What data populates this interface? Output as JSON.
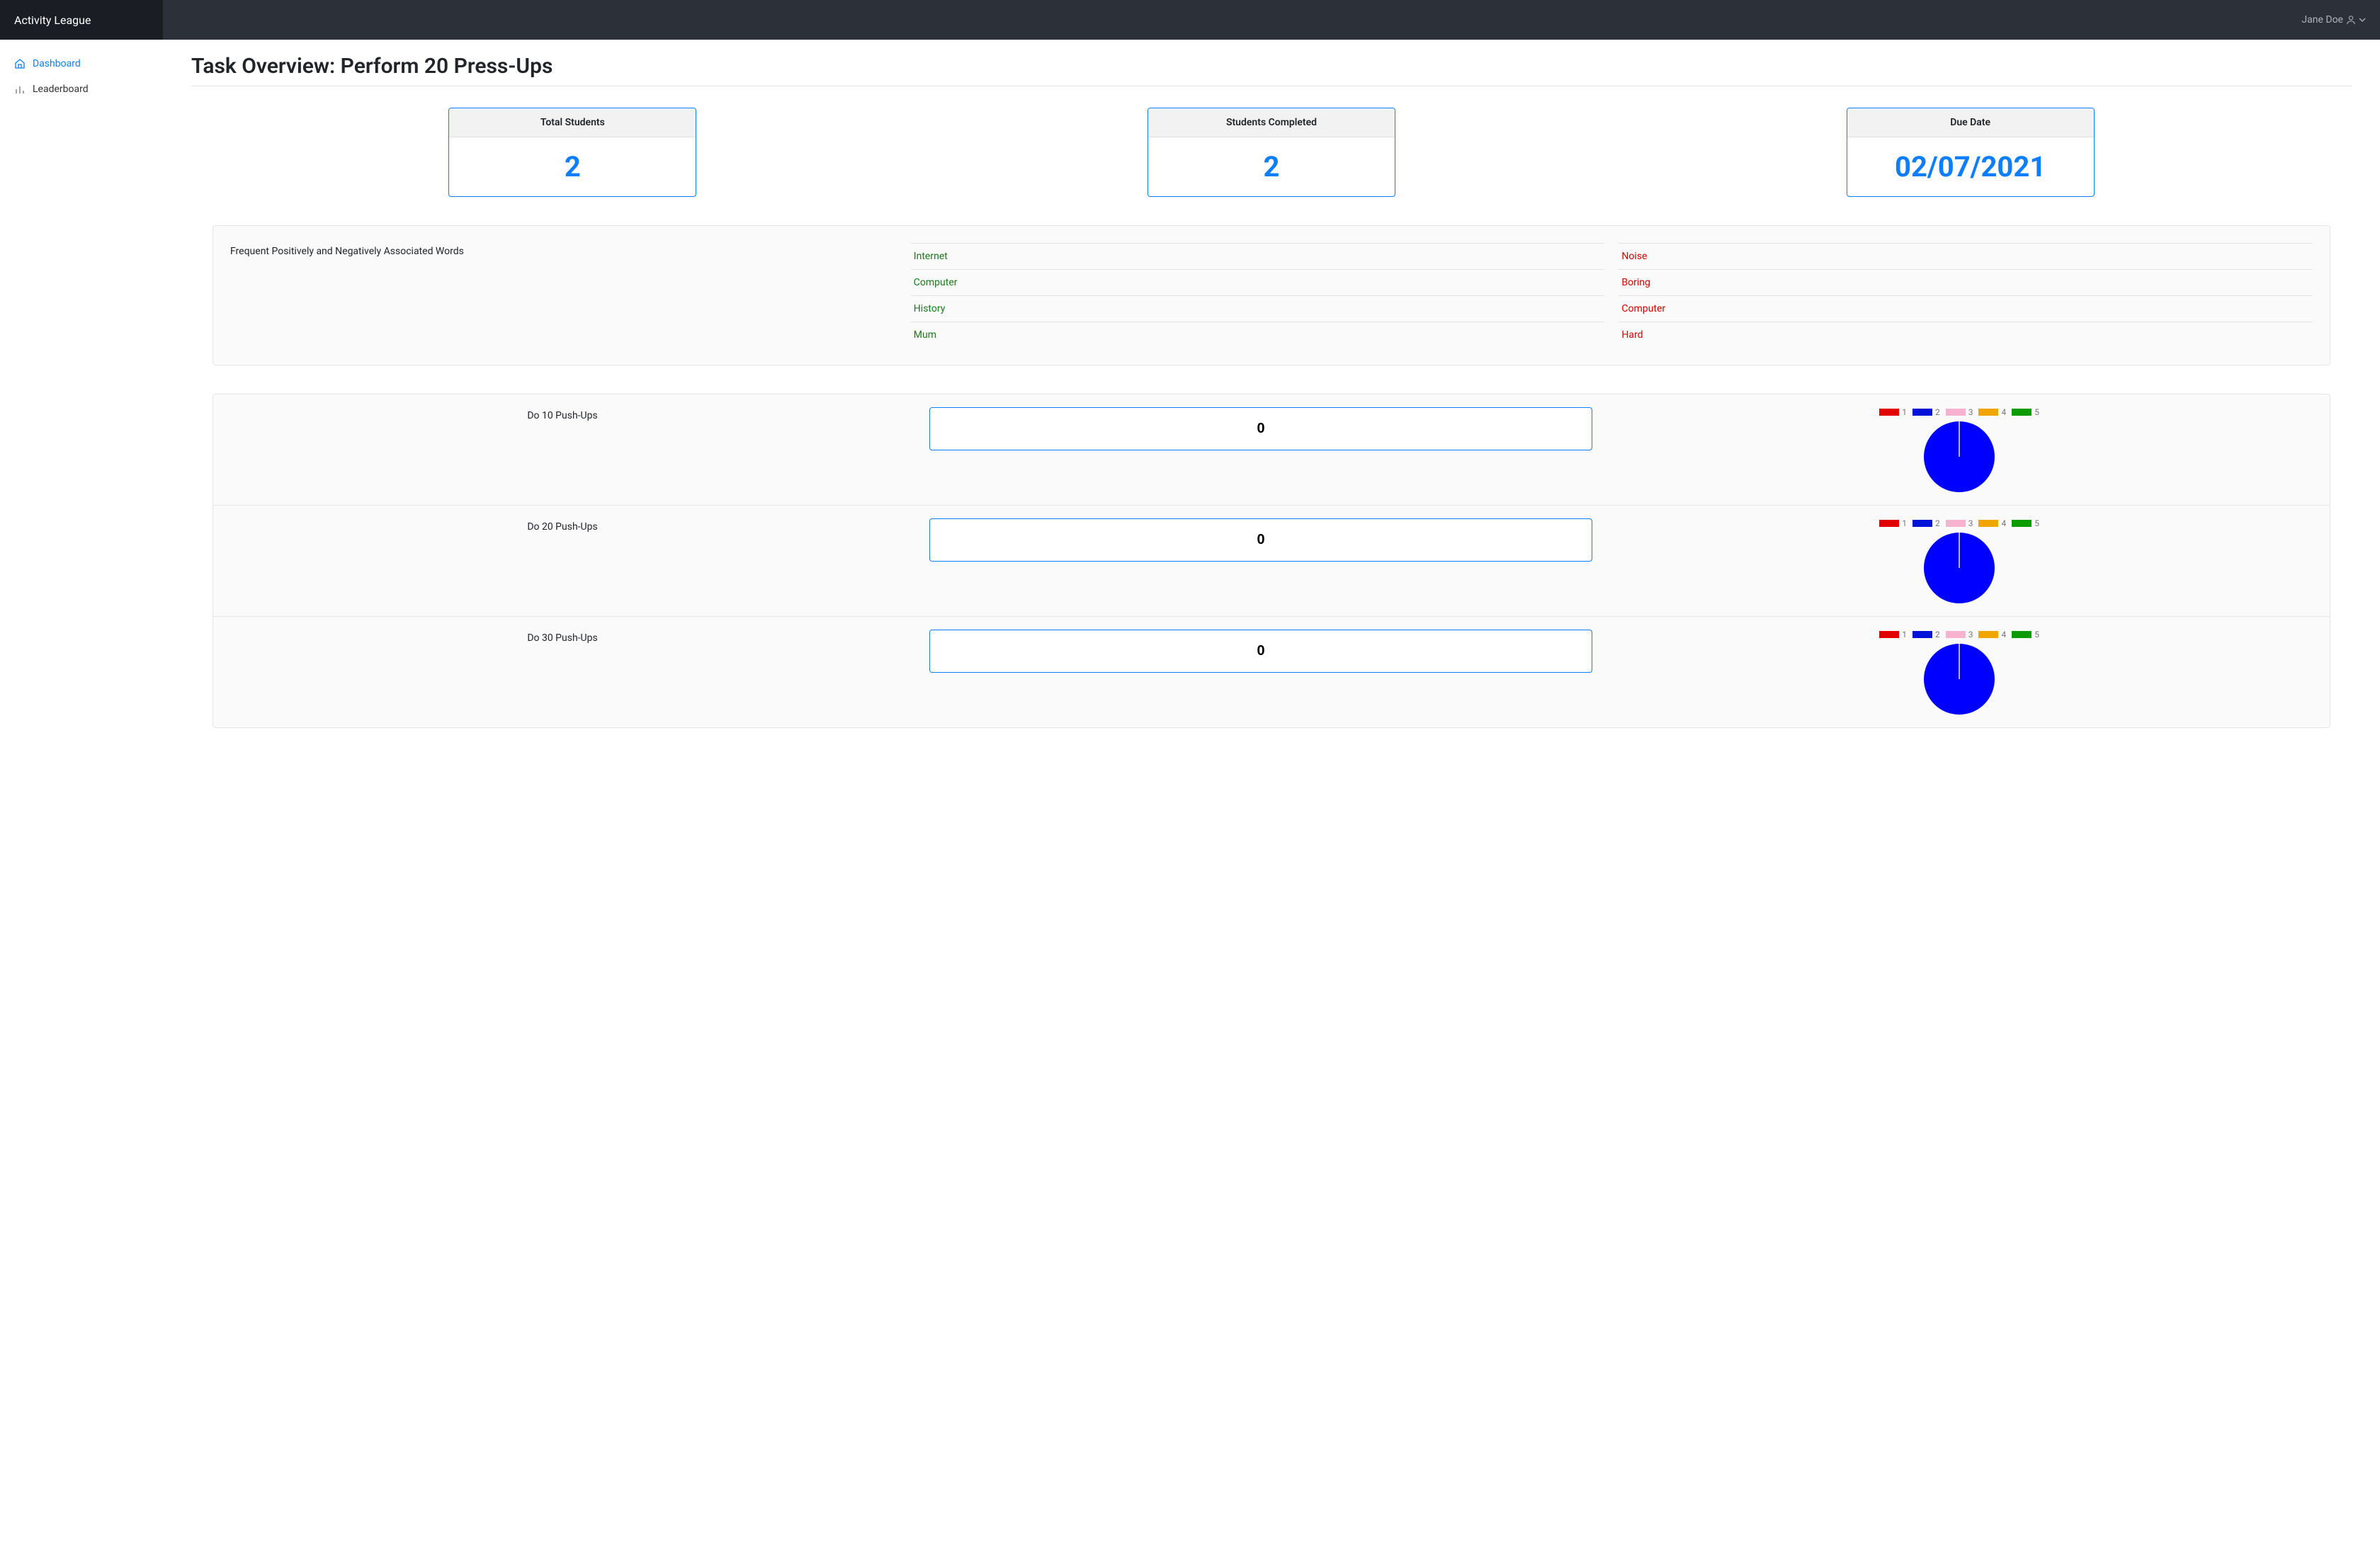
{
  "brand": "Activity League",
  "user": {
    "name": "Jane Doe"
  },
  "sidebar": {
    "items": [
      {
        "label": "Dashboard",
        "active": true
      },
      {
        "label": "Leaderboard",
        "active": false
      }
    ]
  },
  "page_title": "Task Overview: Perform 20 Press-Ups",
  "stats": [
    {
      "label": "Total Students",
      "value": "2"
    },
    {
      "label": "Students Completed",
      "value": "2"
    },
    {
      "label": "Due Date",
      "value": "02/07/2021"
    }
  ],
  "words": {
    "panel_label": "Frequent Positively and Negatively Associated Words",
    "positive": [
      "Internet",
      "Computer",
      "History",
      "Mum"
    ],
    "negative": [
      "Noise",
      "Boring",
      "Computer",
      "Hard"
    ]
  },
  "legend_labels": [
    "1",
    "2",
    "3",
    "4",
    "5"
  ],
  "legend_colors": [
    "#e30000",
    "#0013d6",
    "#f7b2cf",
    "#f0a500",
    "#0c9c00"
  ],
  "tasks": [
    {
      "name": "Do 10 Push-Ups",
      "value": "0"
    },
    {
      "name": "Do 20 Push-Ups",
      "value": "0"
    },
    {
      "name": "Do 30 Push-Ups",
      "value": "0"
    }
  ],
  "chart_data": [
    {
      "type": "pie",
      "title": "Do 10 Push-Ups",
      "categories": [
        "1",
        "2",
        "3",
        "4",
        "5"
      ],
      "values": [
        0,
        100,
        0,
        0,
        0
      ],
      "colors": [
        "#e30000",
        "#0013d6",
        "#f7b2cf",
        "#f0a500",
        "#0c9c00"
      ]
    },
    {
      "type": "pie",
      "title": "Do 20 Push-Ups",
      "categories": [
        "1",
        "2",
        "3",
        "4",
        "5"
      ],
      "values": [
        0,
        100,
        0,
        0,
        0
      ],
      "colors": [
        "#e30000",
        "#0013d6",
        "#f7b2cf",
        "#f0a500",
        "#0c9c00"
      ]
    },
    {
      "type": "pie",
      "title": "Do 30 Push-Ups",
      "categories": [
        "1",
        "2",
        "3",
        "4",
        "5"
      ],
      "values": [
        0,
        100,
        0,
        0,
        0
      ],
      "colors": [
        "#e30000",
        "#0013d6",
        "#f7b2cf",
        "#f0a500",
        "#0c9c00"
      ]
    }
  ]
}
